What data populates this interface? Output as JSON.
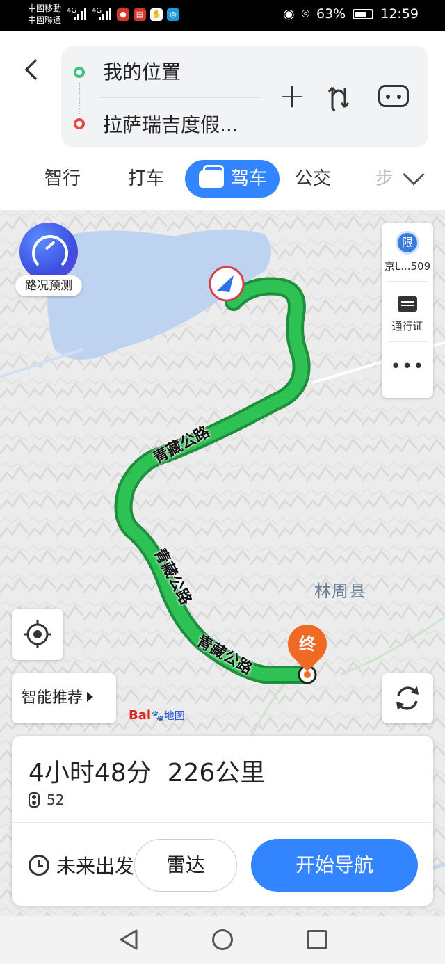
{
  "status_bar": {
    "carrier_1": "中國移動",
    "carrier_2": "中國聯通",
    "network_1": "4G",
    "network_2": "4G",
    "battery": "63%",
    "time": "12:59"
  },
  "header": {
    "start_location": "我的位置",
    "end_location": "拉萨瑞吉度假...",
    "tabs": [
      {
        "label": "智行",
        "active": false
      },
      {
        "label": "打车",
        "active": false
      },
      {
        "label": "驾车",
        "active": true
      },
      {
        "label": "公交",
        "active": false
      },
      {
        "label": "步",
        "active": false
      }
    ]
  },
  "map": {
    "traffic_forecast_label": "路况预测",
    "restriction_badge": "限",
    "plate_label": "京L...509",
    "permit_label": "通行证",
    "more_label": "•••",
    "road_name": "青藏公路",
    "county_label": "林周县",
    "end_marker": "终",
    "smart_recommend_label": "智能推荐",
    "baidu_logo": "Bai",
    "baidu_logo_map": "地图",
    "route_color": "#22b24c",
    "lake_color": "#bdd3ef"
  },
  "route_card": {
    "duration": "4小时48分",
    "distance": "226公里",
    "traffic_lights": "52",
    "future_departure_label": "未来出发",
    "radar_label": "雷达",
    "start_nav_label": "开始导航"
  },
  "colors": {
    "accent": "#3385ff",
    "start_dot": "#3cc47c",
    "end_dot": "#e8483b",
    "end_pin": "#f06a24"
  }
}
